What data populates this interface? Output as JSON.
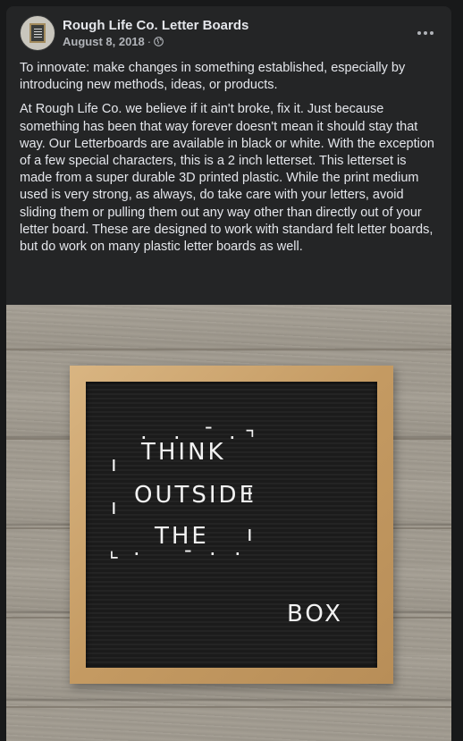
{
  "post": {
    "page_name": "Rough Life Co. Letter Boards",
    "date": "August 8, 2018",
    "separator": "·",
    "audience_icon": "globe-icon",
    "more_icon": "more-horizontal-icon",
    "paragraphs": [
      "To innovate: make changes in something established, especially by introducing new methods, ideas, or products.",
      "At Rough Life Co. we believe if it ain't broke, fix it. Just because something has been that way forever doesn't mean it should stay that way. Our Letterboards are available in black or white. With the exception of a few special characters, this is a 2 inch letterset. This letterset is made from a super durable 3D printed plastic. While the print medium used is very strong, as always, do take care with your letters, avoid sliding them or pulling them out any way other than directly out of your letter board. These are designed to work with standard felt letter boards, but do work on many plastic letter boards as well."
    ]
  },
  "photo": {
    "board_lines": [
      "THINK",
      "OUTSIDE",
      "THE",
      "BOX"
    ],
    "colors": {
      "felt": "#1e1e1e",
      "frame": "#c49a62",
      "letters": "#f2f2f2",
      "floor": "#a29c91"
    }
  }
}
